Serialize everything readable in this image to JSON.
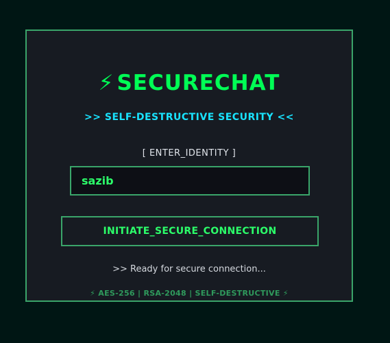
{
  "app": {
    "title": "SECURECHAT",
    "title_icon": "⚡",
    "subtitle": ">> SELF-DESTRUCTIVE SECURITY <<"
  },
  "login": {
    "label": "[ ENTER_IDENTITY ]",
    "username_value": "sazib",
    "connect_label": "INITIATE_SECURE_CONNECTION",
    "status": ">> Ready for secure connection..."
  },
  "footer": {
    "text": "⚡ AES-256 | RSA-2048 | SELF-DESTRUCTIVE ⚡"
  },
  "colors": {
    "page_background": "#001614",
    "panel_background": "#171b22",
    "accent_green": "#00ff55",
    "border_green": "#3aa56a",
    "accent_cyan": "#19e3ff"
  }
}
